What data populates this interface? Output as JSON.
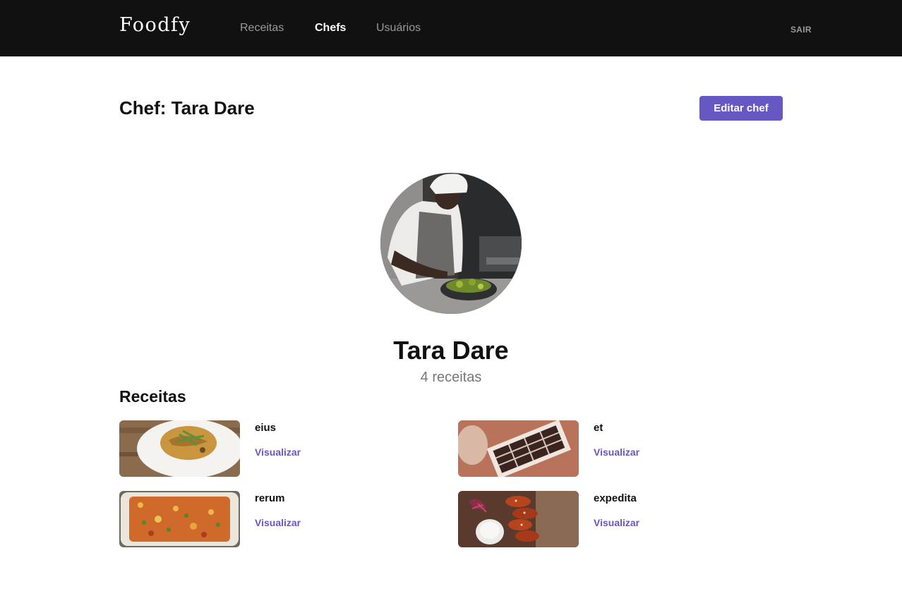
{
  "header": {
    "logo": "Foodfy",
    "nav": [
      {
        "label": "Receitas",
        "active": false
      },
      {
        "label": "Chefs",
        "active": true
      },
      {
        "label": "Usuários",
        "active": false
      }
    ],
    "logout_label": "SAIR"
  },
  "page": {
    "title": "Chef: Tara Dare",
    "edit_button": "Editar chef"
  },
  "chef": {
    "name": "Tara Dare",
    "recipes_count": "4 receitas",
    "avatar_icon": "chef-photo"
  },
  "recipes_section": {
    "title": "Receitas",
    "items": [
      {
        "title": "eius",
        "link": "Visualizar",
        "image": "pasta-plate-photo"
      },
      {
        "title": "et",
        "link": "Visualizar",
        "image": "chocolate-box-photo"
      },
      {
        "title": "rerum",
        "link": "Visualizar",
        "image": "baked-casserole-photo"
      },
      {
        "title": "expedita",
        "link": "Visualizar",
        "image": "chicken-wings-photo"
      }
    ]
  },
  "colors": {
    "header_bg": "#111111",
    "accent": "#6558c3",
    "muted": "#777777"
  }
}
